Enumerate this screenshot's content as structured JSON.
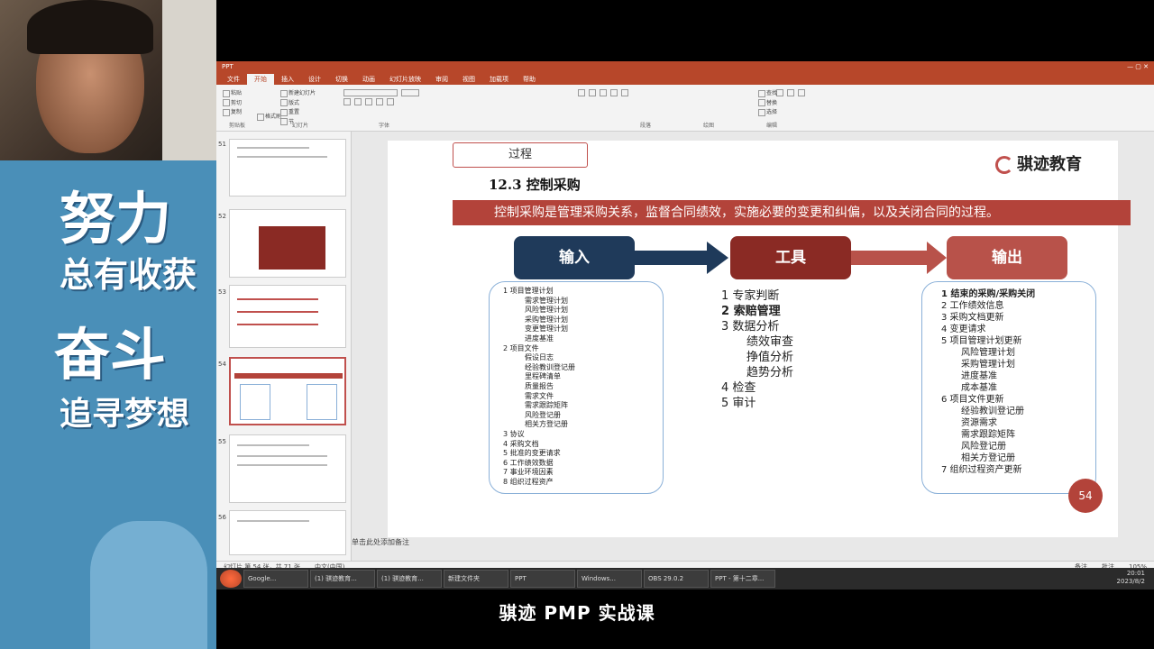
{
  "overlay": {
    "motto_lines": [
      "努力",
      "总有收获",
      "奋斗",
      "追寻梦想"
    ]
  },
  "window": {
    "title": "PPT",
    "menu_tabs": [
      "文件",
      "开始",
      "插入",
      "设计",
      "切换",
      "动画",
      "幻灯片放映",
      "审阅",
      "视图",
      "加载项",
      "帮助"
    ],
    "active_tab_index": 1,
    "ribbon_groups": [
      "剪贴板",
      "幻灯片",
      "字体",
      "段落",
      "绘图",
      "编辑"
    ],
    "ribbon_buttons": {
      "paste": "粘贴",
      "cut": "剪切",
      "copy": "复制",
      "format_painter": "格式刷",
      "new_slide": "新建幻灯片",
      "layout": "版式",
      "reset": "重置",
      "section": "节",
      "find": "查找",
      "replace": "替换",
      "select": "选择"
    }
  },
  "thumbnails": [
    {
      "num": "51",
      "selected": false
    },
    {
      "num": "52",
      "selected": false
    },
    {
      "num": "53",
      "selected": false
    },
    {
      "num": "54",
      "selected": true
    },
    {
      "num": "55",
      "selected": false
    },
    {
      "num": "56",
      "selected": false
    }
  ],
  "notes_placeholder": "单击此处添加备注",
  "status": {
    "slide_info": "幻灯片 第 54 张，共 71 张",
    "lang": "中文(中国)",
    "notes": "备注",
    "comments": "批注",
    "zoom": "105%"
  },
  "slide": {
    "process_label": "过程",
    "section_title": "12.3  控制采购",
    "logo_text": "骐迹教育",
    "description": "控制采购是管理采购关系，监督合同绩效，实施必要的变更和纠偏，以及关闭合同的过程。",
    "headers": {
      "input": "输入",
      "tools": "工具",
      "output": "输出"
    },
    "inputs": [
      "1 项目管理计划",
      "需求管理计划",
      "风险管理计划",
      "采购管理计划",
      "变更管理计划",
      "进度基准",
      "2 项目文件",
      "假设日志",
      "经验教训登记册",
      "里程碑清单",
      "质量报告",
      "需求文件",
      "需求跟踪矩阵",
      "风险登记册",
      "相关方登记册",
      "3 协议",
      "4 采购文档",
      "5 批准的变更请求",
      "6 工作绩效数据",
      "7 事业环境因素",
      "8 组织过程资产"
    ],
    "tools": [
      "1 专家判断",
      "2 索赔管理",
      "3 数据分析",
      "绩效审查",
      "挣值分析",
      "趋势分析",
      "4 检查",
      "5 审计"
    ],
    "outputs": [
      "1 结束的采购/采购关闭",
      "2 工作绩效信息",
      "3 采购文档更新",
      "4 变更请求",
      "5 项目管理计划更新",
      "风险管理计划",
      "采购管理计划",
      "进度基准",
      "成本基准",
      "6 项目文件更新",
      "经验教训登记册",
      "资源需求",
      "需求跟踪矩阵",
      "风险登记册",
      "相关方登记册",
      "7 组织过程资产更新"
    ],
    "page_number": "54",
    "colors": {
      "input_header": "#1f3a5a",
      "tools_header": "#8a2a24",
      "output_header": "#b8524a",
      "banner": "#b3433a"
    }
  },
  "taskbar": {
    "items": [
      "Google...",
      "(1) 骐迹教育...",
      "(1) 骐迹教育...",
      "新建文件夹",
      "PPT",
      "Windows...",
      "OBS 29.0.2",
      "PPT - 第十二章..."
    ],
    "time": "20:01",
    "date": "2023/8/2"
  },
  "subtitle": "骐迹 PMP 实战课"
}
